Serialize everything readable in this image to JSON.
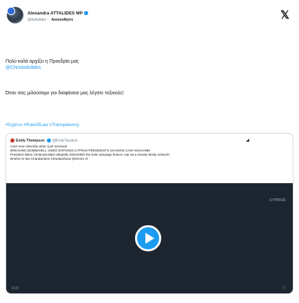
{
  "author": {
    "name": "Alexandra ATTALIDES MP",
    "handle": "@Aattalides",
    "follow_label": "Ακολουθήστε"
  },
  "tweet": {
    "para1": "Πολύ καλά αρχίζει η Προεδρία μας",
    "para1_mention": "@Christodulides",
    "para2": "Όταν σας μιλούσαμε για διαφάνεια μας λέγατε τοξικούς!",
    "hashtags": "#Cyprus #RuleOfLaw #Transparency"
  },
  "quoted": {
    "name": "Emily Thompson",
    "handle": "@EmilyTanalyst",
    "line1": "Can't even describe what I just received!",
    "line2": "BREAKING BOMBSHELL VIDEO EXPOSES CYPRUS PRESIDENT'S SHADOW CASH MACHINE!",
    "line3": "President Nikos Christodoulides allegedly SMASHED the €1M campaign finance cap via a sneaky family network!",
    "line4": "Brother-in-law Charalambos Charalambous (Director of"
  },
  "video": {
    "overlay_text": "CYPRUS",
    "timestamp": "4:20",
    "info_icon": "info-icon"
  }
}
